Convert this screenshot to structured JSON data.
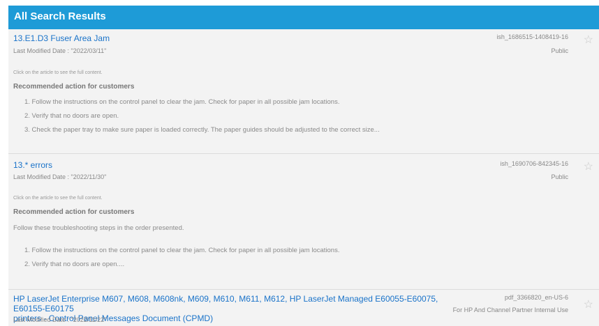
{
  "header": {
    "title": "All Search Results"
  },
  "results": [
    {
      "title": "13.E1.D3 Fuser Area Jam",
      "modified": "Last Modified Date : \"2022/03/11\"",
      "id": "ish_1686515-1408419-16",
      "access": "Public",
      "hint": "Click on the article to see the full content.",
      "section": "Recommended action for customers",
      "steps": [
        "1. Follow the instructions on the control panel to clear the jam. Check for paper in all possible jam locations.",
        "2. Verify that no doors are open.",
        "3. Check the paper tray to make sure paper is loaded correctly. The paper guides should be adjusted to the correct size..."
      ]
    },
    {
      "title": "13.* errors",
      "modified": "Last Modified Date : \"2022/11/30\"",
      "id": "ish_1690706-842345-16",
      "access": "Public",
      "hint": "Click on the article to see the full content.",
      "section": "Recommended action for customers",
      "intro": "Follow these troubleshooting steps in the order presented.",
      "steps": [
        "1. Follow the instructions on the control panel to clear the jam. Check for paper in all possible jam locations.",
        "2. Verify that no doors are open...."
      ]
    },
    {
      "title_line1": "HP LaserJet Enterprise M607, M608, M608nk, M609, M610, M611, M612, HP LaserJet Managed E60055-E60075, E60155-E60175",
      "title_line2": "printers - Control Panel Messages Document (CPMD)",
      "modified": "Last Modified Date : \"2022/11/22\"",
      "id": "pdf_3366820_en-US-6",
      "access": "For HP And Channel Partner Internal Use"
    }
  ],
  "icons": {
    "favorite": "star-outline-icon"
  }
}
